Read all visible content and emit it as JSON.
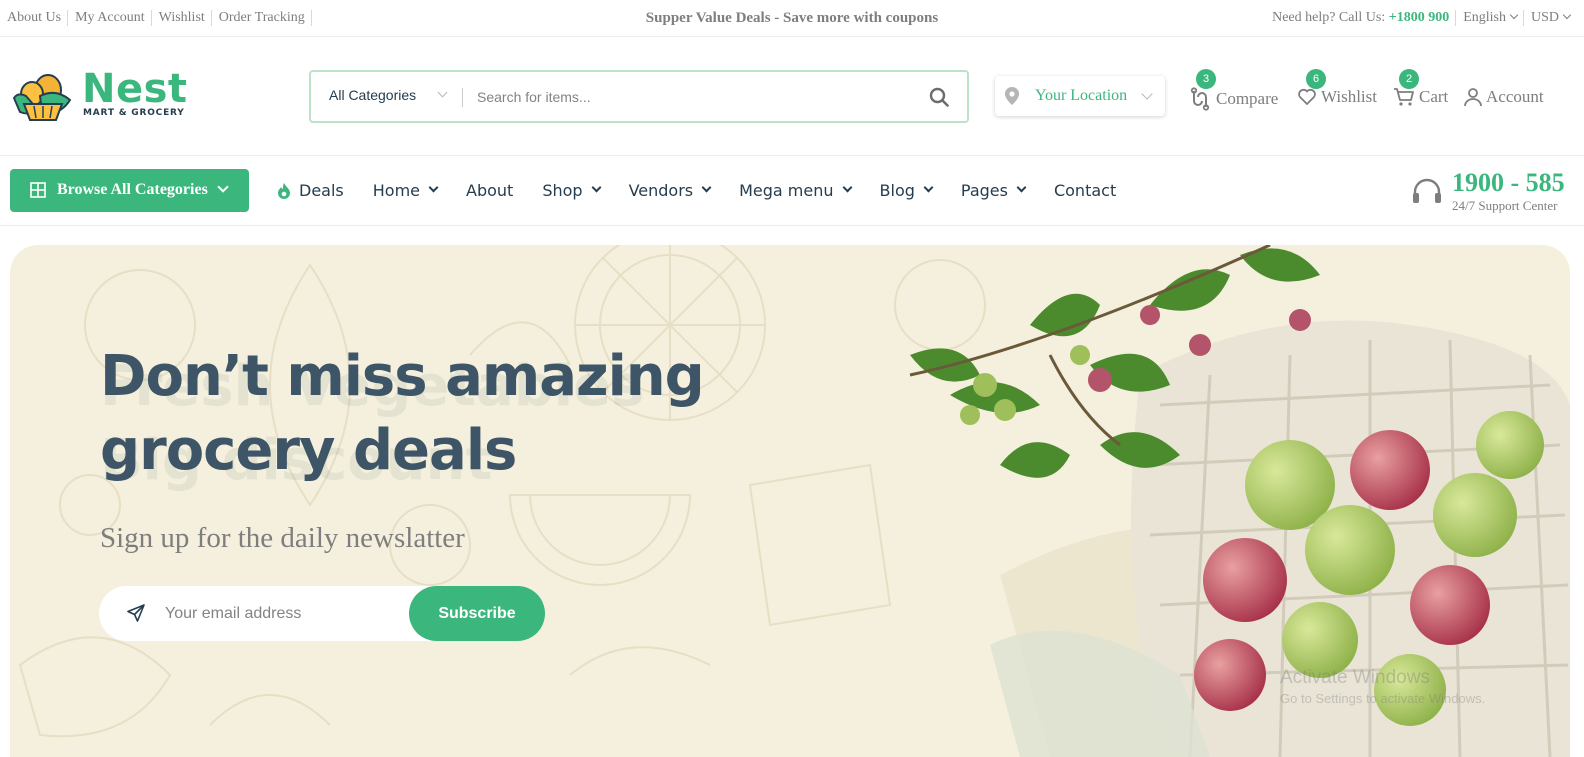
{
  "topbar": {
    "links": [
      "About Us",
      "My Account",
      "Wishlist",
      "Order Tracking"
    ],
    "promo": "Supper Value Deals - Save more with coupons",
    "help_prefix": "Need help? Call Us:",
    "help_phone": "+1800 900",
    "language": "English",
    "currency": "USD"
  },
  "header": {
    "logo": {
      "brand": "Nest",
      "tagline": "MART & GROCERY"
    },
    "search": {
      "category": "All Categories",
      "placeholder": "Search for items..."
    },
    "location": "Your Location",
    "compare": {
      "label": "Compare",
      "count": "3"
    },
    "wishlist": {
      "label": "Wishlist",
      "count": "6"
    },
    "cart": {
      "label": "Cart",
      "count": "2"
    },
    "account": {
      "label": "Account"
    }
  },
  "nav": {
    "browse": "Browse All Categories",
    "items": [
      {
        "label": "Deals",
        "dropdown": false
      },
      {
        "label": "Home",
        "dropdown": true
      },
      {
        "label": "About",
        "dropdown": false
      },
      {
        "label": "Shop",
        "dropdown": true
      },
      {
        "label": "Vendors",
        "dropdown": true
      },
      {
        "label": "Mega menu",
        "dropdown": true
      },
      {
        "label": "Blog",
        "dropdown": true
      },
      {
        "label": "Pages",
        "dropdown": true
      },
      {
        "label": "Contact",
        "dropdown": false
      }
    ],
    "support_phone": "1900 - 585",
    "support_label": "24/7 Support Center"
  },
  "hero": {
    "title_line1": "Don’t miss amazing",
    "title_line2": "grocery deals",
    "ghost_line1": "Fresh Vegetables",
    "ghost_line2": "Big discount",
    "subtitle": "Sign up for the daily newslatter",
    "email_placeholder": "Your email address",
    "subscribe": "Subscribe"
  },
  "overlay": {
    "activate_title": "Activate Windows",
    "activate_sub": "Go to Settings to activate Windows."
  },
  "colors": {
    "brand_green": "#3bb77e",
    "heading": "#253d4e",
    "muted": "#7e7e7e",
    "hero_bg": "#f5f0dd"
  }
}
